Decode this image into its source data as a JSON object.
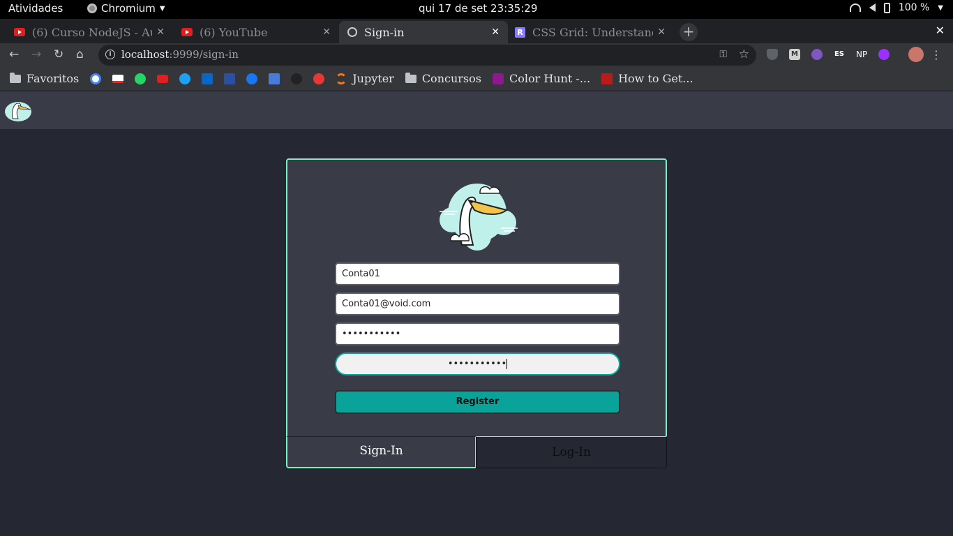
{
  "os": {
    "activities": "Atividades",
    "app_name": "Chromium",
    "clock": "qui 17 de set  23:35:29",
    "battery": "100 %"
  },
  "tabs": [
    {
      "title": "(6) Curso NodeJS - Au",
      "favicon": "youtube-icon"
    },
    {
      "title": "(6) YouTube",
      "favicon": "youtube-icon"
    },
    {
      "title": "Sign-in",
      "favicon": "globe-icon"
    },
    {
      "title": "CSS Grid: Understand",
      "favicon": "r-icon"
    }
  ],
  "address": {
    "host": "localhost",
    "path": ":9999/sign-in"
  },
  "extensions": [
    {
      "name": "shield-icon",
      "label": "",
      "color": "#5f6368"
    },
    {
      "name": "m-icon",
      "label": "M",
      "color": "#d0d0d0"
    },
    {
      "name": "eye-icon",
      "label": "",
      "color": "#7e57c2"
    },
    {
      "name": "es-icon",
      "label": "ES",
      "color": "#35363a"
    },
    {
      "name": "np-icon",
      "label": "NP",
      "color": "#35363a"
    },
    {
      "name": "vpn-icon",
      "label": "",
      "color": "#9b30ff"
    }
  ],
  "bookmarks": [
    {
      "label": "Favoritos",
      "icon": "folder-icon"
    },
    {
      "label": "",
      "icon": "google-icon",
      "color": "#fff"
    },
    {
      "label": "",
      "icon": "gmail-icon",
      "color": "#d93025"
    },
    {
      "label": "",
      "icon": "whatsapp-icon",
      "color": "#25d366"
    },
    {
      "label": "",
      "icon": "youtube-icon",
      "color": "#e02020"
    },
    {
      "label": "",
      "icon": "twitter-icon",
      "color": "#1da1f2"
    },
    {
      "label": "",
      "icon": "linkedin-icon",
      "color": "#0a66c2"
    },
    {
      "label": "",
      "icon": "trello-icon",
      "color": "#2a4fa3"
    },
    {
      "label": "",
      "icon": "facebook-icon",
      "color": "#1877f2"
    },
    {
      "label": "",
      "icon": "translate-icon",
      "color": "#4a7bd8"
    },
    {
      "label": "",
      "icon": "spotify-icon",
      "color": "#222"
    },
    {
      "label": "",
      "icon": "tomato-icon",
      "color": "#e53935"
    },
    {
      "label": "Jupyter",
      "icon": "jupyter-icon",
      "color": "#f37626"
    },
    {
      "label": "Concursos",
      "icon": "folder-icon"
    },
    {
      "label": "Color Hunt -...",
      "icon": "colorhunt-icon",
      "color": "#8b1a8b"
    },
    {
      "label": "How to Get...",
      "icon": "w-icon",
      "color": "#b71c1c"
    }
  ],
  "form": {
    "name": "Conta01",
    "email": "Conta01@void.com",
    "password": "•••••••••••",
    "confirm_password": "•••••••••••",
    "register_label": "Register"
  },
  "bottom_tabs": {
    "signin": "Sign-In",
    "login": "Log-In"
  },
  "colors": {
    "accent": "#7bf0c4",
    "button": "#0aa39a",
    "panel": "#393c47",
    "background": "#252833"
  }
}
